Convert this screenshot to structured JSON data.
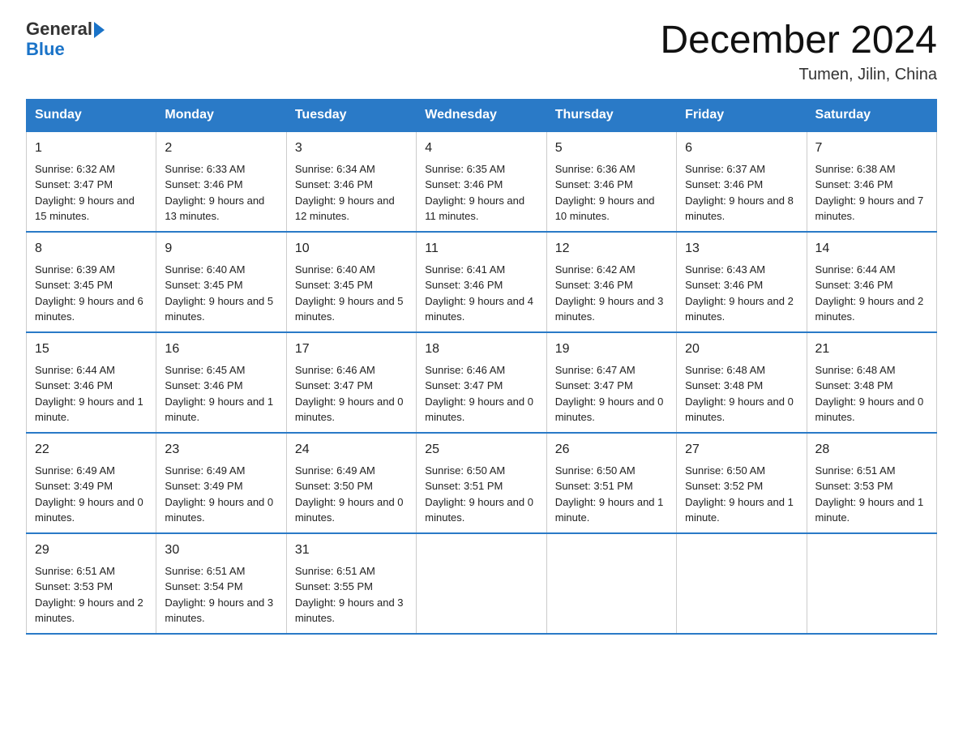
{
  "header": {
    "logo_general": "General",
    "logo_blue": "Blue",
    "title": "December 2024",
    "subtitle": "Tumen, Jilin, China"
  },
  "calendar": {
    "headers": [
      "Sunday",
      "Monday",
      "Tuesday",
      "Wednesday",
      "Thursday",
      "Friday",
      "Saturday"
    ],
    "weeks": [
      [
        {
          "day": "1",
          "sunrise": "Sunrise: 6:32 AM",
          "sunset": "Sunset: 3:47 PM",
          "daylight": "Daylight: 9 hours and 15 minutes."
        },
        {
          "day": "2",
          "sunrise": "Sunrise: 6:33 AM",
          "sunset": "Sunset: 3:46 PM",
          "daylight": "Daylight: 9 hours and 13 minutes."
        },
        {
          "day": "3",
          "sunrise": "Sunrise: 6:34 AM",
          "sunset": "Sunset: 3:46 PM",
          "daylight": "Daylight: 9 hours and 12 minutes."
        },
        {
          "day": "4",
          "sunrise": "Sunrise: 6:35 AM",
          "sunset": "Sunset: 3:46 PM",
          "daylight": "Daylight: 9 hours and 11 minutes."
        },
        {
          "day": "5",
          "sunrise": "Sunrise: 6:36 AM",
          "sunset": "Sunset: 3:46 PM",
          "daylight": "Daylight: 9 hours and 10 minutes."
        },
        {
          "day": "6",
          "sunrise": "Sunrise: 6:37 AM",
          "sunset": "Sunset: 3:46 PM",
          "daylight": "Daylight: 9 hours and 8 minutes."
        },
        {
          "day": "7",
          "sunrise": "Sunrise: 6:38 AM",
          "sunset": "Sunset: 3:46 PM",
          "daylight": "Daylight: 9 hours and 7 minutes."
        }
      ],
      [
        {
          "day": "8",
          "sunrise": "Sunrise: 6:39 AM",
          "sunset": "Sunset: 3:45 PM",
          "daylight": "Daylight: 9 hours and 6 minutes."
        },
        {
          "day": "9",
          "sunrise": "Sunrise: 6:40 AM",
          "sunset": "Sunset: 3:45 PM",
          "daylight": "Daylight: 9 hours and 5 minutes."
        },
        {
          "day": "10",
          "sunrise": "Sunrise: 6:40 AM",
          "sunset": "Sunset: 3:45 PM",
          "daylight": "Daylight: 9 hours and 5 minutes."
        },
        {
          "day": "11",
          "sunrise": "Sunrise: 6:41 AM",
          "sunset": "Sunset: 3:46 PM",
          "daylight": "Daylight: 9 hours and 4 minutes."
        },
        {
          "day": "12",
          "sunrise": "Sunrise: 6:42 AM",
          "sunset": "Sunset: 3:46 PM",
          "daylight": "Daylight: 9 hours and 3 minutes."
        },
        {
          "day": "13",
          "sunrise": "Sunrise: 6:43 AM",
          "sunset": "Sunset: 3:46 PM",
          "daylight": "Daylight: 9 hours and 2 minutes."
        },
        {
          "day": "14",
          "sunrise": "Sunrise: 6:44 AM",
          "sunset": "Sunset: 3:46 PM",
          "daylight": "Daylight: 9 hours and 2 minutes."
        }
      ],
      [
        {
          "day": "15",
          "sunrise": "Sunrise: 6:44 AM",
          "sunset": "Sunset: 3:46 PM",
          "daylight": "Daylight: 9 hours and 1 minute."
        },
        {
          "day": "16",
          "sunrise": "Sunrise: 6:45 AM",
          "sunset": "Sunset: 3:46 PM",
          "daylight": "Daylight: 9 hours and 1 minute."
        },
        {
          "day": "17",
          "sunrise": "Sunrise: 6:46 AM",
          "sunset": "Sunset: 3:47 PM",
          "daylight": "Daylight: 9 hours and 0 minutes."
        },
        {
          "day": "18",
          "sunrise": "Sunrise: 6:46 AM",
          "sunset": "Sunset: 3:47 PM",
          "daylight": "Daylight: 9 hours and 0 minutes."
        },
        {
          "day": "19",
          "sunrise": "Sunrise: 6:47 AM",
          "sunset": "Sunset: 3:47 PM",
          "daylight": "Daylight: 9 hours and 0 minutes."
        },
        {
          "day": "20",
          "sunrise": "Sunrise: 6:48 AM",
          "sunset": "Sunset: 3:48 PM",
          "daylight": "Daylight: 9 hours and 0 minutes."
        },
        {
          "day": "21",
          "sunrise": "Sunrise: 6:48 AM",
          "sunset": "Sunset: 3:48 PM",
          "daylight": "Daylight: 9 hours and 0 minutes."
        }
      ],
      [
        {
          "day": "22",
          "sunrise": "Sunrise: 6:49 AM",
          "sunset": "Sunset: 3:49 PM",
          "daylight": "Daylight: 9 hours and 0 minutes."
        },
        {
          "day": "23",
          "sunrise": "Sunrise: 6:49 AM",
          "sunset": "Sunset: 3:49 PM",
          "daylight": "Daylight: 9 hours and 0 minutes."
        },
        {
          "day": "24",
          "sunrise": "Sunrise: 6:49 AM",
          "sunset": "Sunset: 3:50 PM",
          "daylight": "Daylight: 9 hours and 0 minutes."
        },
        {
          "day": "25",
          "sunrise": "Sunrise: 6:50 AM",
          "sunset": "Sunset: 3:51 PM",
          "daylight": "Daylight: 9 hours and 0 minutes."
        },
        {
          "day": "26",
          "sunrise": "Sunrise: 6:50 AM",
          "sunset": "Sunset: 3:51 PM",
          "daylight": "Daylight: 9 hours and 1 minute."
        },
        {
          "day": "27",
          "sunrise": "Sunrise: 6:50 AM",
          "sunset": "Sunset: 3:52 PM",
          "daylight": "Daylight: 9 hours and 1 minute."
        },
        {
          "day": "28",
          "sunrise": "Sunrise: 6:51 AM",
          "sunset": "Sunset: 3:53 PM",
          "daylight": "Daylight: 9 hours and 1 minute."
        }
      ],
      [
        {
          "day": "29",
          "sunrise": "Sunrise: 6:51 AM",
          "sunset": "Sunset: 3:53 PM",
          "daylight": "Daylight: 9 hours and 2 minutes."
        },
        {
          "day": "30",
          "sunrise": "Sunrise: 6:51 AM",
          "sunset": "Sunset: 3:54 PM",
          "daylight": "Daylight: 9 hours and 3 minutes."
        },
        {
          "day": "31",
          "sunrise": "Sunrise: 6:51 AM",
          "sunset": "Sunset: 3:55 PM",
          "daylight": "Daylight: 9 hours and 3 minutes."
        },
        null,
        null,
        null,
        null
      ]
    ]
  }
}
